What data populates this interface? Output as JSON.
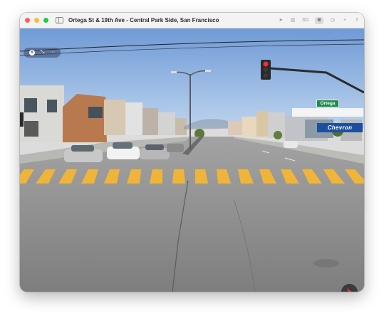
{
  "window": {
    "title": "Ortega St & 19th Ave - Central Park Side, San Francisco"
  },
  "toolbar": {
    "items": [
      {
        "name": "location-arrow-icon",
        "glyph": "➤"
      },
      {
        "name": "map-icon",
        "glyph": "▥"
      },
      {
        "name": "3d-button",
        "glyph": "3D"
      },
      {
        "name": "look-around-binoculars-icon",
        "glyph": "⊛"
      },
      {
        "name": "clock-icon",
        "glyph": "◷"
      },
      {
        "name": "add-icon",
        "glyph": "+"
      },
      {
        "name": "share-icon",
        "glyph": "⇪"
      }
    ]
  },
  "overlay": {
    "close_glyph": "✕",
    "collapse_glyph": "⤡",
    "more_glyph": "···"
  },
  "signs": {
    "street_name": "Ortega",
    "gas_station": "Chevron"
  },
  "colors": {
    "sky": "#7fa9dd",
    "road": "#8f8f8f",
    "crosswalk": "#f1b43a",
    "sign_green": "#1f8a4c",
    "chevron_blue": "#1d4fa0"
  }
}
